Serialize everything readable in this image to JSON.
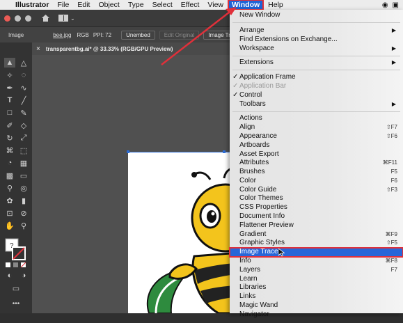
{
  "menubar": {
    "app_name": "Illustrator",
    "items": [
      "File",
      "Edit",
      "Object",
      "Type",
      "Select",
      "Effect",
      "View"
    ],
    "active_item": "Window",
    "after_item": "Help"
  },
  "control_bar": {
    "type_label": "Image",
    "file_name": "bee.jpg",
    "color_mode": "RGB",
    "ppi": "PPI: 72",
    "unembed": "Unembed",
    "edit_original": "Edit Original",
    "image_trace": "Image Trace"
  },
  "document_tab": {
    "close": "×",
    "title": "transparentbg.ai* @ 33.33% (RGB/GPU Preview)"
  },
  "menu": {
    "items": [
      {
        "label": "New Window",
        "shortcut": "",
        "submenu": false,
        "check": false,
        "dim": false,
        "hl": false
      },
      {
        "label": "Arrange",
        "shortcut": "",
        "submenu": true,
        "check": false,
        "dim": false,
        "hl": false
      },
      {
        "label": "Find Extensions on Exchange...",
        "shortcut": "",
        "submenu": false,
        "check": false,
        "dim": false,
        "hl": false
      },
      {
        "label": "Workspace",
        "shortcut": "",
        "submenu": true,
        "check": false,
        "dim": false,
        "hl": false
      },
      {
        "label": "Extensions",
        "shortcut": "",
        "submenu": true,
        "check": false,
        "dim": false,
        "hl": false
      },
      {
        "label": "Application Frame",
        "shortcut": "",
        "submenu": false,
        "check": true,
        "dim": false,
        "hl": false
      },
      {
        "label": "Application Bar",
        "shortcut": "",
        "submenu": false,
        "check": true,
        "dim": true,
        "hl": false
      },
      {
        "label": "Control",
        "shortcut": "",
        "submenu": false,
        "check": true,
        "dim": false,
        "hl": false
      },
      {
        "label": "Toolbars",
        "shortcut": "",
        "submenu": true,
        "check": false,
        "dim": false,
        "hl": false
      },
      {
        "label": "Actions",
        "shortcut": "",
        "submenu": false,
        "check": false,
        "dim": false,
        "hl": false
      },
      {
        "label": "Align",
        "shortcut": "⇧F7",
        "submenu": false,
        "check": false,
        "dim": false,
        "hl": false
      },
      {
        "label": "Appearance",
        "shortcut": "⇧F6",
        "submenu": false,
        "check": false,
        "dim": false,
        "hl": false
      },
      {
        "label": "Artboards",
        "shortcut": "",
        "submenu": false,
        "check": false,
        "dim": false,
        "hl": false
      },
      {
        "label": "Asset Export",
        "shortcut": "",
        "submenu": false,
        "check": false,
        "dim": false,
        "hl": false
      },
      {
        "label": "Attributes",
        "shortcut": "⌘F11",
        "submenu": false,
        "check": false,
        "dim": false,
        "hl": false
      },
      {
        "label": "Brushes",
        "shortcut": "F5",
        "submenu": false,
        "check": false,
        "dim": false,
        "hl": false
      },
      {
        "label": "Color",
        "shortcut": "F6",
        "submenu": false,
        "check": false,
        "dim": false,
        "hl": false
      },
      {
        "label": "Color Guide",
        "shortcut": "⇧F3",
        "submenu": false,
        "check": false,
        "dim": false,
        "hl": false
      },
      {
        "label": "Color Themes",
        "shortcut": "",
        "submenu": false,
        "check": false,
        "dim": false,
        "hl": false
      },
      {
        "label": "CSS Properties",
        "shortcut": "",
        "submenu": false,
        "check": false,
        "dim": false,
        "hl": false
      },
      {
        "label": "Document Info",
        "shortcut": "",
        "submenu": false,
        "check": false,
        "dim": false,
        "hl": false
      },
      {
        "label": "Flattener Preview",
        "shortcut": "",
        "submenu": false,
        "check": false,
        "dim": false,
        "hl": false
      },
      {
        "label": "Gradient",
        "shortcut": "⌘F9",
        "submenu": false,
        "check": false,
        "dim": false,
        "hl": false
      },
      {
        "label": "Graphic Styles",
        "shortcut": "⇧F5",
        "submenu": false,
        "check": false,
        "dim": false,
        "hl": false
      },
      {
        "label": "Image Trace",
        "shortcut": "",
        "submenu": false,
        "check": false,
        "dim": false,
        "hl": true
      },
      {
        "label": "Info",
        "shortcut": "⌘F8",
        "submenu": false,
        "check": false,
        "dim": false,
        "hl": false
      },
      {
        "label": "Layers",
        "shortcut": "F7",
        "submenu": false,
        "check": false,
        "dim": false,
        "hl": false
      },
      {
        "label": "Learn",
        "shortcut": "",
        "submenu": false,
        "check": false,
        "dim": false,
        "hl": false
      },
      {
        "label": "Libraries",
        "shortcut": "",
        "submenu": false,
        "check": false,
        "dim": false,
        "hl": false
      },
      {
        "label": "Links",
        "shortcut": "",
        "submenu": false,
        "check": false,
        "dim": false,
        "hl": false
      },
      {
        "label": "Magic Wand",
        "shortcut": "",
        "submenu": false,
        "check": false,
        "dim": false,
        "hl": false
      },
      {
        "label": "Navigator",
        "shortcut": "",
        "submenu": false,
        "check": false,
        "dim": false,
        "hl": false
      }
    ]
  },
  "colors": {
    "highlight": "#2866d8",
    "annotation_red": "#e0303a",
    "bee_yellow": "#f3c41c",
    "leaf_green": "#2e8b3e"
  },
  "icons": [
    "apple-icon",
    "home-icon",
    "workspace-grid-icon",
    "selection-tool-icon",
    "direct-selection-icon",
    "pen-tool-icon",
    "type-tool-icon",
    "rectangle-tool-icon",
    "brush-tool-icon",
    "eraser-tool-icon",
    "rotate-tool-icon",
    "hand-tool-icon",
    "zoom-tool-icon",
    "fill-stroke-icon",
    "more-tools-icon"
  ]
}
